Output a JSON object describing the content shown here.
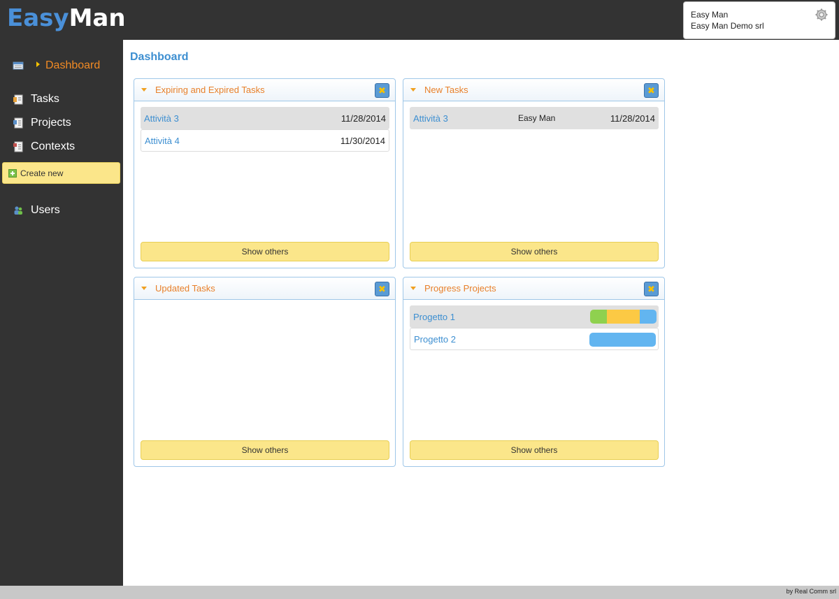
{
  "app": {
    "logo_part1": "Easy",
    "logo_part2": "Man",
    "footer": "by Real Comm srl"
  },
  "user": {
    "name": "Easy Man",
    "company": "Easy Man Demo srl"
  },
  "sidebar": {
    "items": [
      {
        "label": "Dashboard",
        "icon": "dashboard-icon"
      },
      {
        "label": "Tasks",
        "icon": "tasks-icon"
      },
      {
        "label": "Projects",
        "icon": "projects-icon"
      },
      {
        "label": "Contexts",
        "icon": "contexts-icon"
      },
      {
        "label": "Users",
        "icon": "users-icon"
      }
    ],
    "create_new": "Create new"
  },
  "main": {
    "title": "Dashboard",
    "show_others": "Show others",
    "panels": {
      "expiring": {
        "title": "Expiring and Expired Tasks",
        "rows": [
          {
            "name": "Attività 3",
            "date": "11/28/2014"
          },
          {
            "name": "Attività 4",
            "date": "11/30/2014"
          }
        ]
      },
      "new_tasks": {
        "title": "New Tasks",
        "rows": [
          {
            "name": "Attività 3",
            "owner": "Easy Man",
            "date": "11/28/2014"
          }
        ]
      },
      "updated": {
        "title": "Updated Tasks",
        "rows": []
      },
      "progress": {
        "title": "Progress Projects",
        "rows": [
          {
            "name": "Progetto 1",
            "progress": [
              {
                "fraction": 0.25,
                "color": "#8fd14f"
              },
              {
                "fraction": 0.5,
                "color": "#fcc944"
              },
              {
                "fraction": 0.25,
                "color": "#62b5f0"
              }
            ]
          },
          {
            "name": "Progetto 2",
            "progress": [
              {
                "fraction": 1.0,
                "color": "#62b5f0"
              }
            ]
          }
        ]
      }
    }
  },
  "colors": {
    "accent_orange": "#f08a24",
    "link_blue": "#3d8fd1",
    "button_yellow": "#fbe68a",
    "sidebar_bg": "#333333"
  }
}
